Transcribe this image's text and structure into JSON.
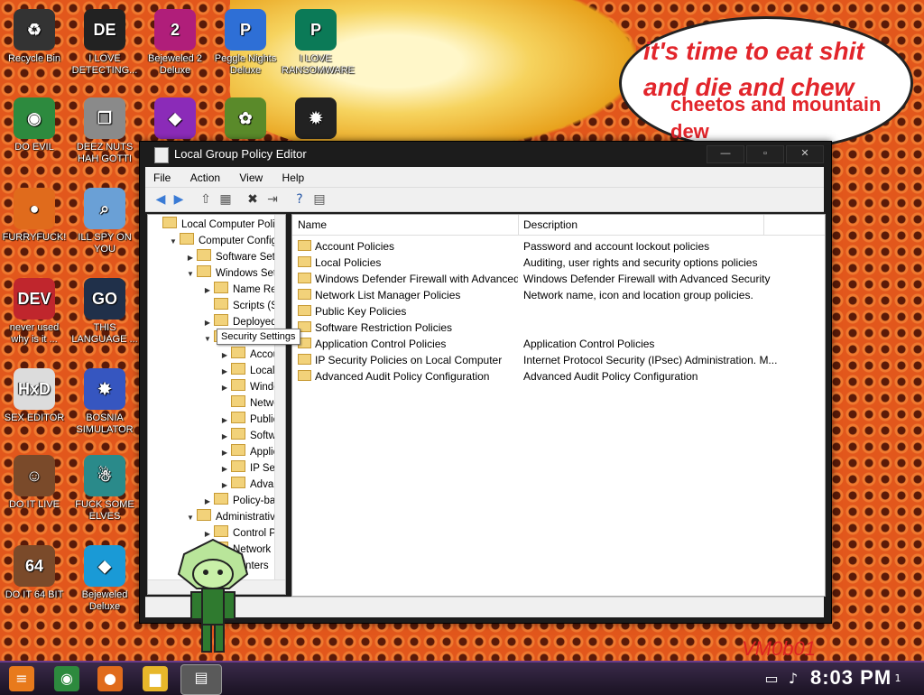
{
  "wallpaper": {
    "speech_line1": "it's time to eat shit and die and chew",
    "speech_line2": "cheetos and mountain dew",
    "watermark": "VM0b01"
  },
  "desktop_icons": [
    {
      "label": "Recycle Bin",
      "icon": "recycle-bin-icon",
      "color": "#333333",
      "glyph": "♻"
    },
    {
      "label": "I LOVE DETECTING...",
      "icon": "detect-it-easy-icon",
      "color": "#222222",
      "glyph": "DE"
    },
    {
      "label": "Bejeweled 2 Deluxe",
      "icon": "bejeweled-2-icon",
      "color": "#b01e7a",
      "glyph": "2"
    },
    {
      "label": "Peggle Nights Deluxe",
      "icon": "peggle-nights-icon",
      "color": "#2e6fd6",
      "glyph": "P"
    },
    {
      "label": "I LOVE RANSOMWARE",
      "icon": "publisher-icon",
      "color": "#0b7a57",
      "glyph": "P"
    },
    {
      "label": "DO EVIL",
      "icon": "chrome-icon",
      "color": "#2d8a3e",
      "glyph": "◉"
    },
    {
      "label": "DEEZ NUTS HAH GOTTI",
      "icon": "copy-windows-icon",
      "color": "#8a8a8a",
      "glyph": "❐"
    },
    {
      "label": "",
      "icon": "gem-icon",
      "color": "#8b2bb8",
      "glyph": "◆"
    },
    {
      "label": "",
      "icon": "flower-icon",
      "color": "#5a8a2a",
      "glyph": "✿"
    },
    {
      "label": "",
      "icon": "paw-icon",
      "color": "#222222",
      "glyph": "✹"
    },
    {
      "label": "FURRYFUCK!",
      "icon": "firefox-icon",
      "color": "#e06b1c",
      "glyph": "●"
    },
    {
      "label": "ILL SPY ON YOU",
      "icon": "spy-icon",
      "color": "#6aa0d6",
      "glyph": "⌕"
    },
    {
      "label": "never used why is it ...",
      "icon": "devcpp-icon",
      "color": "#c0262d",
      "glyph": "DEV"
    },
    {
      "label": "THIS LANGUAGE ...",
      "icon": "go-icon",
      "color": "#20304a",
      "glyph": "GO"
    },
    {
      "label": "SEX EDITOR",
      "icon": "hxd-icon",
      "color": "#dcdcdc",
      "glyph": "HxD"
    },
    {
      "label": "BOSNIA SIMULATOR",
      "icon": "mine-icon",
      "color": "#3656c0",
      "glyph": "✸"
    },
    {
      "label": "DO IT LIVE",
      "icon": "portrait-icon",
      "color": "#7a4a2a",
      "glyph": "☺"
    },
    {
      "label": "FUCK SOME ELVES",
      "icon": "santa-icon",
      "color": "#2a8a8a",
      "glyph": "☃"
    },
    {
      "label": "DO IT 64 BIT",
      "icon": "portrait-64-icon",
      "color": "#7a4a2a",
      "glyph": "64"
    },
    {
      "label": "Bejeweled Deluxe",
      "icon": "diamond-icon",
      "color": "#1a9ad6",
      "glyph": "◆"
    }
  ],
  "window": {
    "title": "Local Group Policy Editor",
    "controls": {
      "minimize": "—",
      "maximize": "▫",
      "close": "✕"
    },
    "menu": [
      "File",
      "Action",
      "View",
      "Help"
    ],
    "toolbar_icons": [
      "back-icon",
      "forward-icon",
      "up-folder-icon",
      "show-hide-tree-icon",
      "delete-icon",
      "export-icon",
      "help-icon",
      "properties-icon"
    ],
    "toolbar_glyphs": [
      "◀",
      "▶",
      "⇧",
      "▦",
      "✖",
      "⇥",
      "?",
      "▤"
    ],
    "tree": [
      {
        "label": "Local Computer Policy",
        "indent": 0,
        "arrow": ""
      },
      {
        "label": "Computer Configuration",
        "indent": 1,
        "arrow": "▼"
      },
      {
        "label": "Software Settings",
        "indent": 2,
        "arrow": "▶"
      },
      {
        "label": "Windows Settings",
        "indent": 2,
        "arrow": "▼"
      },
      {
        "label": "Name Resolution Policy",
        "indent": 3,
        "arrow": "▶"
      },
      {
        "label": "Scripts (Startup/Shutdown)",
        "indent": 3,
        "arrow": ""
      },
      {
        "label": "Deployed Printers",
        "indent": 3,
        "arrow": "▶"
      },
      {
        "label": "Security Settings",
        "indent": 3,
        "arrow": "▼"
      },
      {
        "label": "Account Policies",
        "indent": 4,
        "arrow": "▶"
      },
      {
        "label": "Local Policies",
        "indent": 4,
        "arrow": "▶"
      },
      {
        "label": "Windows Defender Firewall",
        "indent": 4,
        "arrow": "▶"
      },
      {
        "label": "Network List Manager",
        "indent": 4,
        "arrow": ""
      },
      {
        "label": "Public Key Policies",
        "indent": 4,
        "arrow": "▶"
      },
      {
        "label": "Software Restriction",
        "indent": 4,
        "arrow": "▶"
      },
      {
        "label": "Application Control",
        "indent": 4,
        "arrow": "▶"
      },
      {
        "label": "IP Security Policies",
        "indent": 4,
        "arrow": "▶"
      },
      {
        "label": "Advanced Audit",
        "indent": 4,
        "arrow": "▶"
      },
      {
        "label": "Policy-based QoS",
        "indent": 3,
        "arrow": "▶"
      },
      {
        "label": "Administrative Templates",
        "indent": 2,
        "arrow": "▼"
      },
      {
        "label": "Control Panel",
        "indent": 3,
        "arrow": "▶"
      },
      {
        "label": "Network",
        "indent": 3,
        "arrow": "▶"
      },
      {
        "label": "Printers",
        "indent": 3,
        "arrow": ""
      }
    ],
    "tooltip": "Security Settings",
    "columns": {
      "name": "Name",
      "description": "Description"
    },
    "rows": [
      {
        "name": "Account Policies",
        "description": "Password and account lockout policies"
      },
      {
        "name": "Local Policies",
        "description": "Auditing, user rights and security options policies"
      },
      {
        "name": "Windows Defender Firewall with Advanced Se...",
        "description": "Windows Defender Firewall with Advanced Security"
      },
      {
        "name": "Network List Manager Policies",
        "description": "Network name, icon and location group policies."
      },
      {
        "name": "Public Key Policies",
        "description": ""
      },
      {
        "name": "Software Restriction Policies",
        "description": ""
      },
      {
        "name": "Application Control Policies",
        "description": "Application Control Policies"
      },
      {
        "name": "IP Security Policies on Local Computer",
        "description": "Internet Protocol Security (IPsec) Administration. M..."
      },
      {
        "name": "Advanced Audit Policy Configuration",
        "description": "Advanced Audit Policy Configuration"
      }
    ]
  },
  "taskbar": {
    "clock": "8:03 PM",
    "notification_count": "1"
  }
}
